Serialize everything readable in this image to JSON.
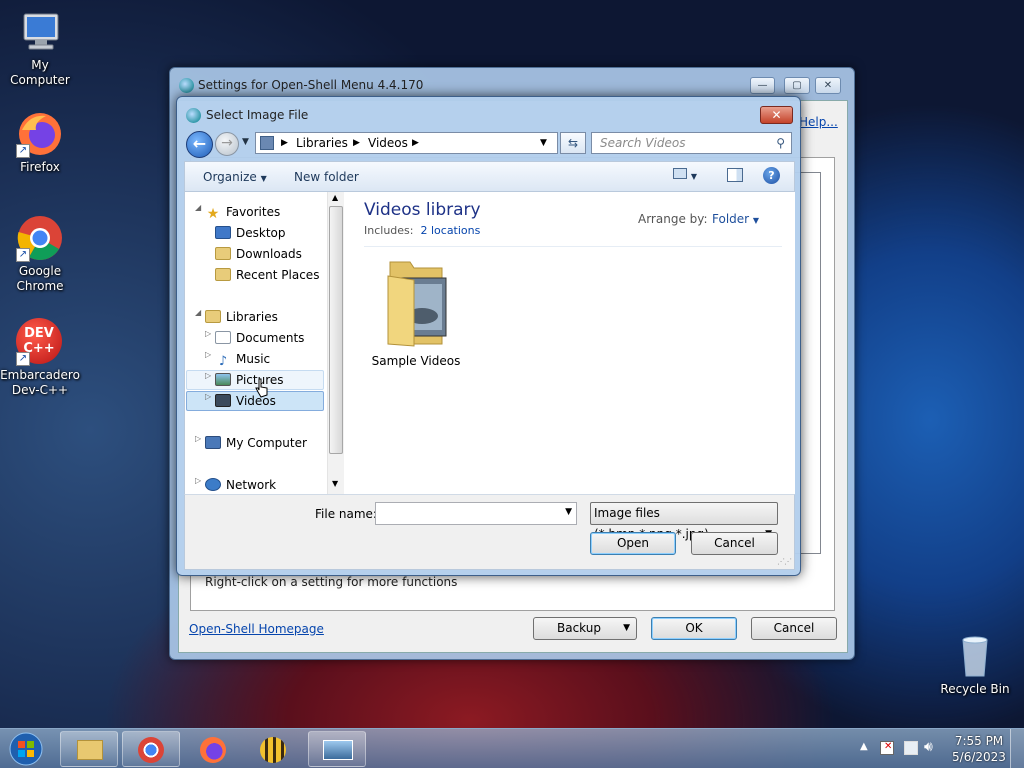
{
  "desktop": {
    "icons": [
      {
        "label": "My Computer"
      },
      {
        "label": "Firefox"
      },
      {
        "label": "Google Chrome"
      },
      {
        "label": "Embarcadero Dev-C++"
      },
      {
        "label": "Recycle Bin"
      }
    ],
    "devcpp_logo": "DEV C++"
  },
  "settings_window": {
    "title": "Settings for Open-Shell Menu 4.4.170",
    "help_link": "Help...",
    "status_text": "Right-click on a setting for more functions",
    "homepage_link": "Open-Shell Homepage",
    "backup_label": "Backup",
    "ok_label": "OK",
    "cancel_label": "Cancel"
  },
  "dialog": {
    "title": "Select Image File",
    "breadcrumb": [
      "Libraries",
      "Videos"
    ],
    "search_placeholder": "Search Videos",
    "toolbar": {
      "organize": "Organize",
      "new_folder": "New folder"
    },
    "nav": {
      "favorites": "Favorites",
      "desktop": "Desktop",
      "downloads": "Downloads",
      "recent_places": "Recent Places",
      "libraries": "Libraries",
      "documents": "Documents",
      "music": "Music",
      "pictures": "Pictures",
      "videos": "Videos",
      "my_computer": "My Computer",
      "network": "Network"
    },
    "library": {
      "title": "Videos library",
      "includes_label": "Includes:",
      "locations": "2 locations",
      "arrange_label": "Arrange by:",
      "arrange_value": "Folder"
    },
    "items": [
      {
        "name": "Sample Videos"
      }
    ],
    "file_name_label": "File name:",
    "file_name_value": "",
    "file_type": "Image files (*.bmp,*.png,*.jpg)",
    "open_label": "Open",
    "cancel_label": "Cancel"
  },
  "taskbar": {
    "time": "7:55 PM",
    "date": "5/6/2023"
  },
  "colors": {
    "selection": "#cce4f7",
    "link": "#0645ad",
    "library_title": "#1e3287",
    "close_button": "#c4432a"
  }
}
